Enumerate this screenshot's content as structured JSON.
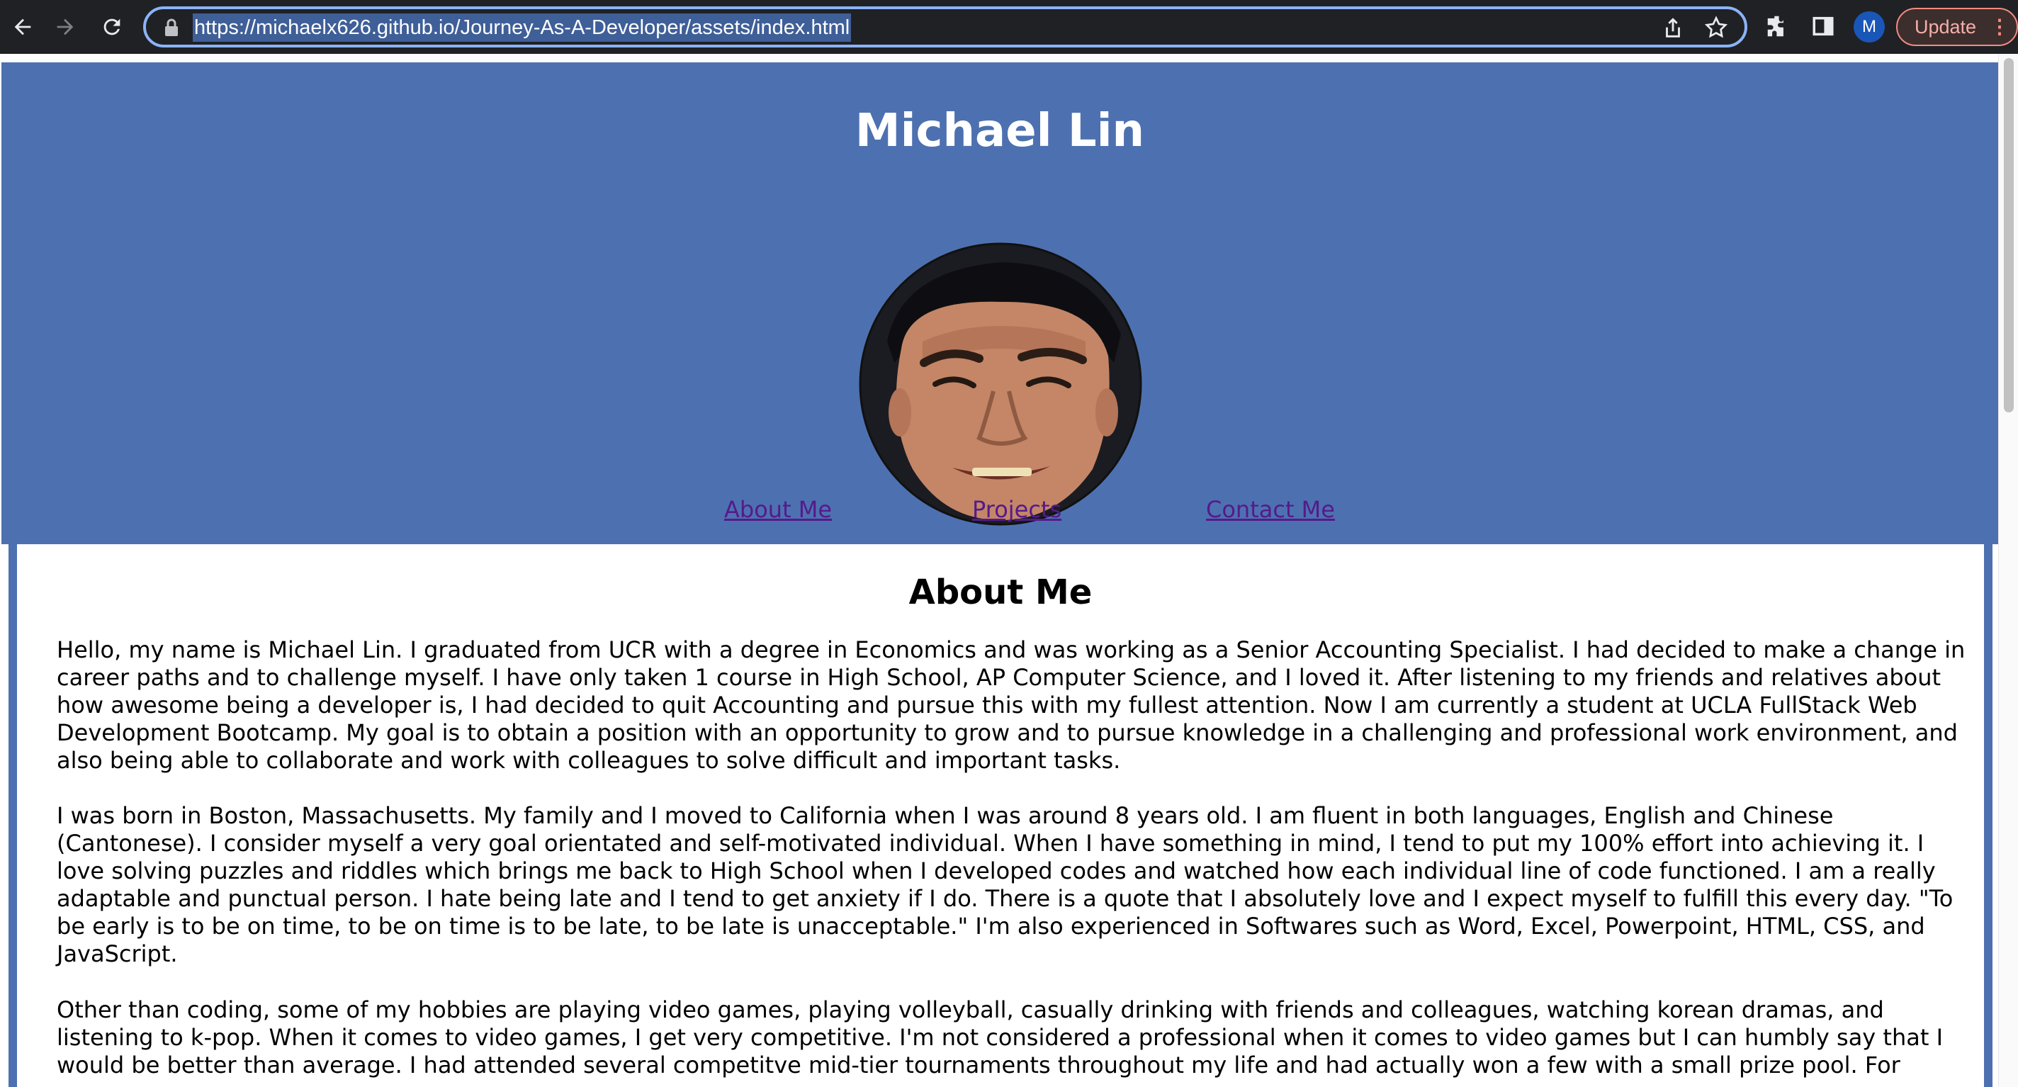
{
  "browser": {
    "url": "https://michaelx626.github.io/Journey-As-A-Developer/assets/index.html",
    "profile_initial": "M",
    "update_label": "Update",
    "accent_color": "#8ab4f8"
  },
  "header": {
    "title": "Michael Lin",
    "background_color": "#4d71b0",
    "nav": {
      "about": "About Me",
      "projects": "Projects",
      "contact": "Contact Me"
    }
  },
  "about": {
    "heading": "About Me",
    "paragraphs": [
      "Hello, my name is Michael Lin. I graduated from UCR with a degree in Economics and was working as a Senior Accounting Specialist. I had decided to make a change in career paths and to challenge myself. I have only taken 1 course in High School, AP Computer Science, and I loved it. After listening to my friends and relatives about how awesome being a developer is, I had decided to quit Accounting and pursue this with my fullest attention. Now I am currently a student at UCLA FullStack Web Development Bootcamp. My goal is to obtain a position with an opportunity to grow and to pursue knowledge in a challenging and professional work environment, and also being able to collaborate and work with colleagues to solve difficult and important tasks.",
      "I was born in Boston, Massachusetts. My family and I moved to California when I was around 8 years old. I am fluent in both languages, English and Chinese (Cantonese). I consider myself a very goal orientated and self-motivated individual. When I have something in mind, I tend to put my 100% effort into achieving it. I love solving puzzles and riddles which brings me back to High School when I developed codes and watched how each individual line of code functioned. I am a really adaptable and punctual person. I hate being late and I tend to get anxiety if I do. There is a quote that I absolutely love and I expect myself to fulfill this every day. \"To be early is to be on time, to be on time is to be late, to be late is unacceptable.\" I'm also experienced in Softwares such as Word, Excel, Powerpoint, HTML, CSS, and JavaScript.",
      "Other than coding, some of my hobbies are playing video games, playing volleyball, casually drinking with friends and colleagues, watching korean dramas, and listening to k-pop. When it comes to video games, I get very competitive. I'm not considered a professional when it comes to video games but I can humbly say that I would be better than average. I had attended several competitve mid-tier tournaments throughout my life and had actually won a few with a small prize pool. For"
    ]
  }
}
